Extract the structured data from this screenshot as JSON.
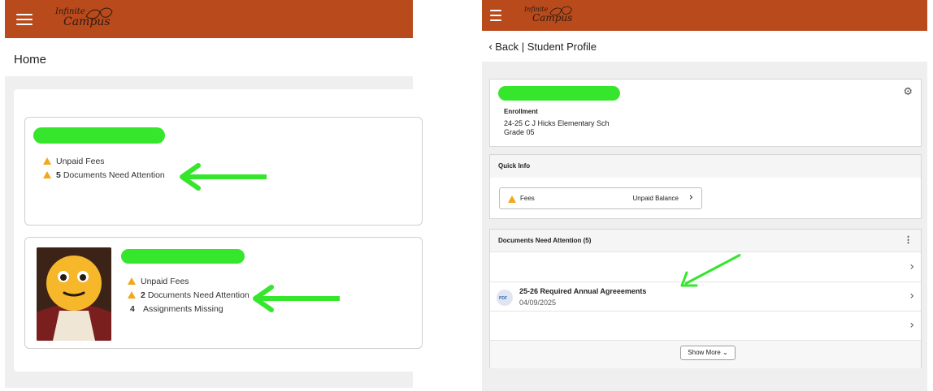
{
  "left": {
    "app_logo": {
      "line1": "Infinite",
      "line2": "Campus"
    },
    "page_title": "Home",
    "student1": {
      "alerts": [
        {
          "count": "",
          "text": "Unpaid Fees"
        },
        {
          "count": "5",
          "text": "Documents Need Attention"
        }
      ]
    },
    "student2": {
      "alerts": [
        {
          "count": "",
          "text": "Unpaid Fees"
        },
        {
          "count": "2",
          "text": "Documents Need Attention"
        },
        {
          "count": "4",
          "text": "Assignments Missing"
        }
      ]
    }
  },
  "right": {
    "app_logo": {
      "line1": "Infinite",
      "line2": "Campus"
    },
    "back_label": "Back | Student Profile",
    "enrollment": {
      "heading": "Enrollment",
      "school": "24-25 C J Hicks Elementary Sch",
      "grade": "Grade 05"
    },
    "quick_info": {
      "heading": "Quick Info",
      "fees_label": "Fees",
      "fees_status": "Unpaid Balance"
    },
    "documents": {
      "heading": "Documents Need Attention (5)",
      "item_title": "25-26 Required Annual Agreeements",
      "item_date": "04/09/2025",
      "file_type": "PDF",
      "show_more": "Show More"
    }
  },
  "colors": {
    "brand": "#b94a1c",
    "warning": "#f2a81d",
    "annotation_green": "#35e62c"
  },
  "icons": [
    "menu-icon",
    "warning-icon",
    "chevron-right-icon",
    "chevron-left-icon",
    "gear-icon",
    "kebab-menu-icon",
    "pdf-file-icon",
    "chevron-down-icon"
  ]
}
